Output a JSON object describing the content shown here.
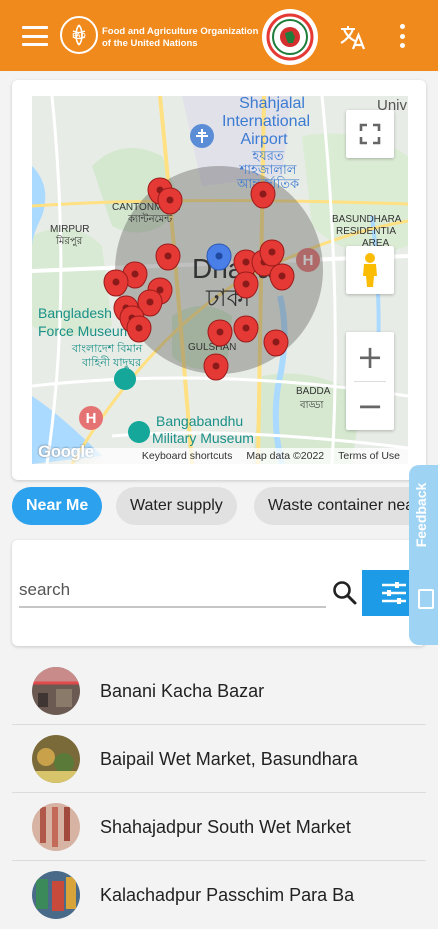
{
  "header": {
    "menu_icon": "hamburger-menu-icon",
    "org_name": "Food and Agriculture Organization\nof the United Nations",
    "translate_icon": "translate-icon",
    "more_icon": "more-vert-icon",
    "brand_color": "#f08a1c"
  },
  "map": {
    "labels": {
      "airport_1": "Shahjalal",
      "airport_2": "International",
      "airport_3": "Airport",
      "airport_bn_1": "হযরত",
      "airport_bn_2": "শাহজালাল",
      "airport_bn_3": "আন্তর্জাতিক",
      "univ": "Univ",
      "cantonment": "CANTONMENT",
      "cantonment_bn": "ক্যান্টনমেন্ট",
      "mirpur": "MIRPUR",
      "mirpur_bn": "মিরপুর",
      "basundhara_1": "BASUNDHARA",
      "basundhara_2": "RESIDENTIA",
      "basundhara_3": "AREA",
      "dhaka": "Dhaka",
      "dhaka_bn": "ঢাকা",
      "museum_1": "Bangladesh",
      "museum_2": "Force Museum",
      "museum_bn_1": "বাংলাদেশ বিমান",
      "museum_bn_2": "বাহিনী যাদুঘর",
      "gulshan": "GULSHAN",
      "badda": "BADDA",
      "badda_bn": "বাড্ডা",
      "military_1": "Bangabandhu",
      "military_2": "Military Museum"
    },
    "footer": {
      "google": "Google",
      "shortcuts": "Keyboard shortcuts",
      "map_data": "Map data ©2022",
      "terms": "Terms of Use"
    },
    "controls": {
      "fullscreen_icon": "fullscreen-icon",
      "pegman_icon": "pegman-icon",
      "zoom_in": "+",
      "zoom_out": "−"
    }
  },
  "chips": [
    {
      "label": "Near Me",
      "active": true
    },
    {
      "label": "Water supply",
      "active": false
    },
    {
      "label": "Waste container nea",
      "active": false
    }
  ],
  "search": {
    "placeholder": "search",
    "value": "",
    "search_icon": "search-icon",
    "filter_icon": "filter-sliders-icon"
  },
  "feedback": {
    "label": "Feedback"
  },
  "markets": [
    {
      "name": "Banani Kacha Bazar"
    },
    {
      "name": "Baipail Wet Market, Basundhara"
    },
    {
      "name": "Shahajadpur South Wet Market"
    },
    {
      "name": "Kalachadpur Passchim Para Ba"
    }
  ]
}
